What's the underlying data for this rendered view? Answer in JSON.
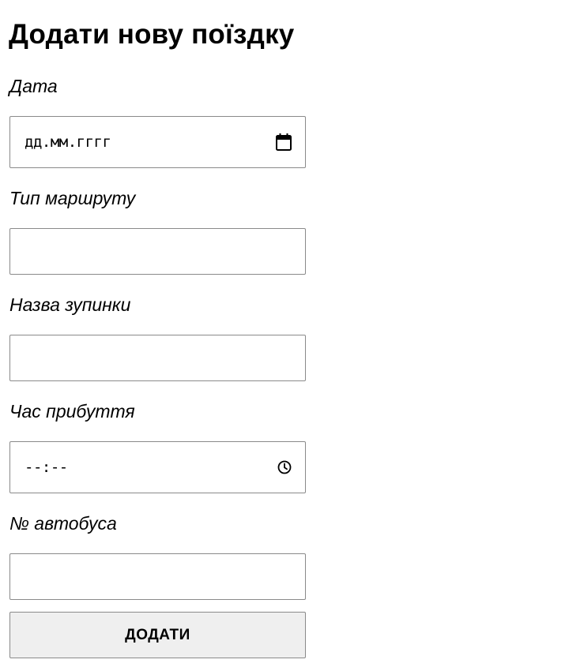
{
  "form": {
    "title": "Додати нову поїздку",
    "date": {
      "label": "Дата",
      "placeholder": "дд.мм.гггг",
      "icon": "calendar-icon"
    },
    "route_type": {
      "label": "Тип маршруту",
      "value": ""
    },
    "stop_name": {
      "label": "Назва зупинки",
      "value": ""
    },
    "arrival_time": {
      "label": "Час прибуття",
      "placeholder": "--:--",
      "icon": "clock-icon"
    },
    "bus_number": {
      "label": "№ автобуса",
      "value": ""
    },
    "submit_label": "ДОДАТИ"
  }
}
